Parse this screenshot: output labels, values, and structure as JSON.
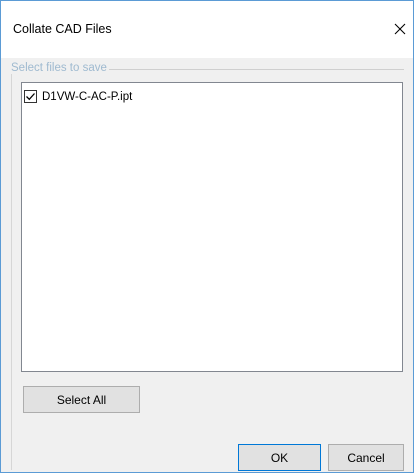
{
  "window": {
    "title": "Collate CAD Files",
    "accent_color": "#0078d7",
    "close_icon": "close-icon"
  },
  "group": {
    "label": "Select files to save"
  },
  "files": [
    {
      "name": "D1VW-C-AC-P.ipt",
      "checked": true
    }
  ],
  "buttons": {
    "select_all": "Select All",
    "ok": "OK",
    "cancel": "Cancel"
  }
}
